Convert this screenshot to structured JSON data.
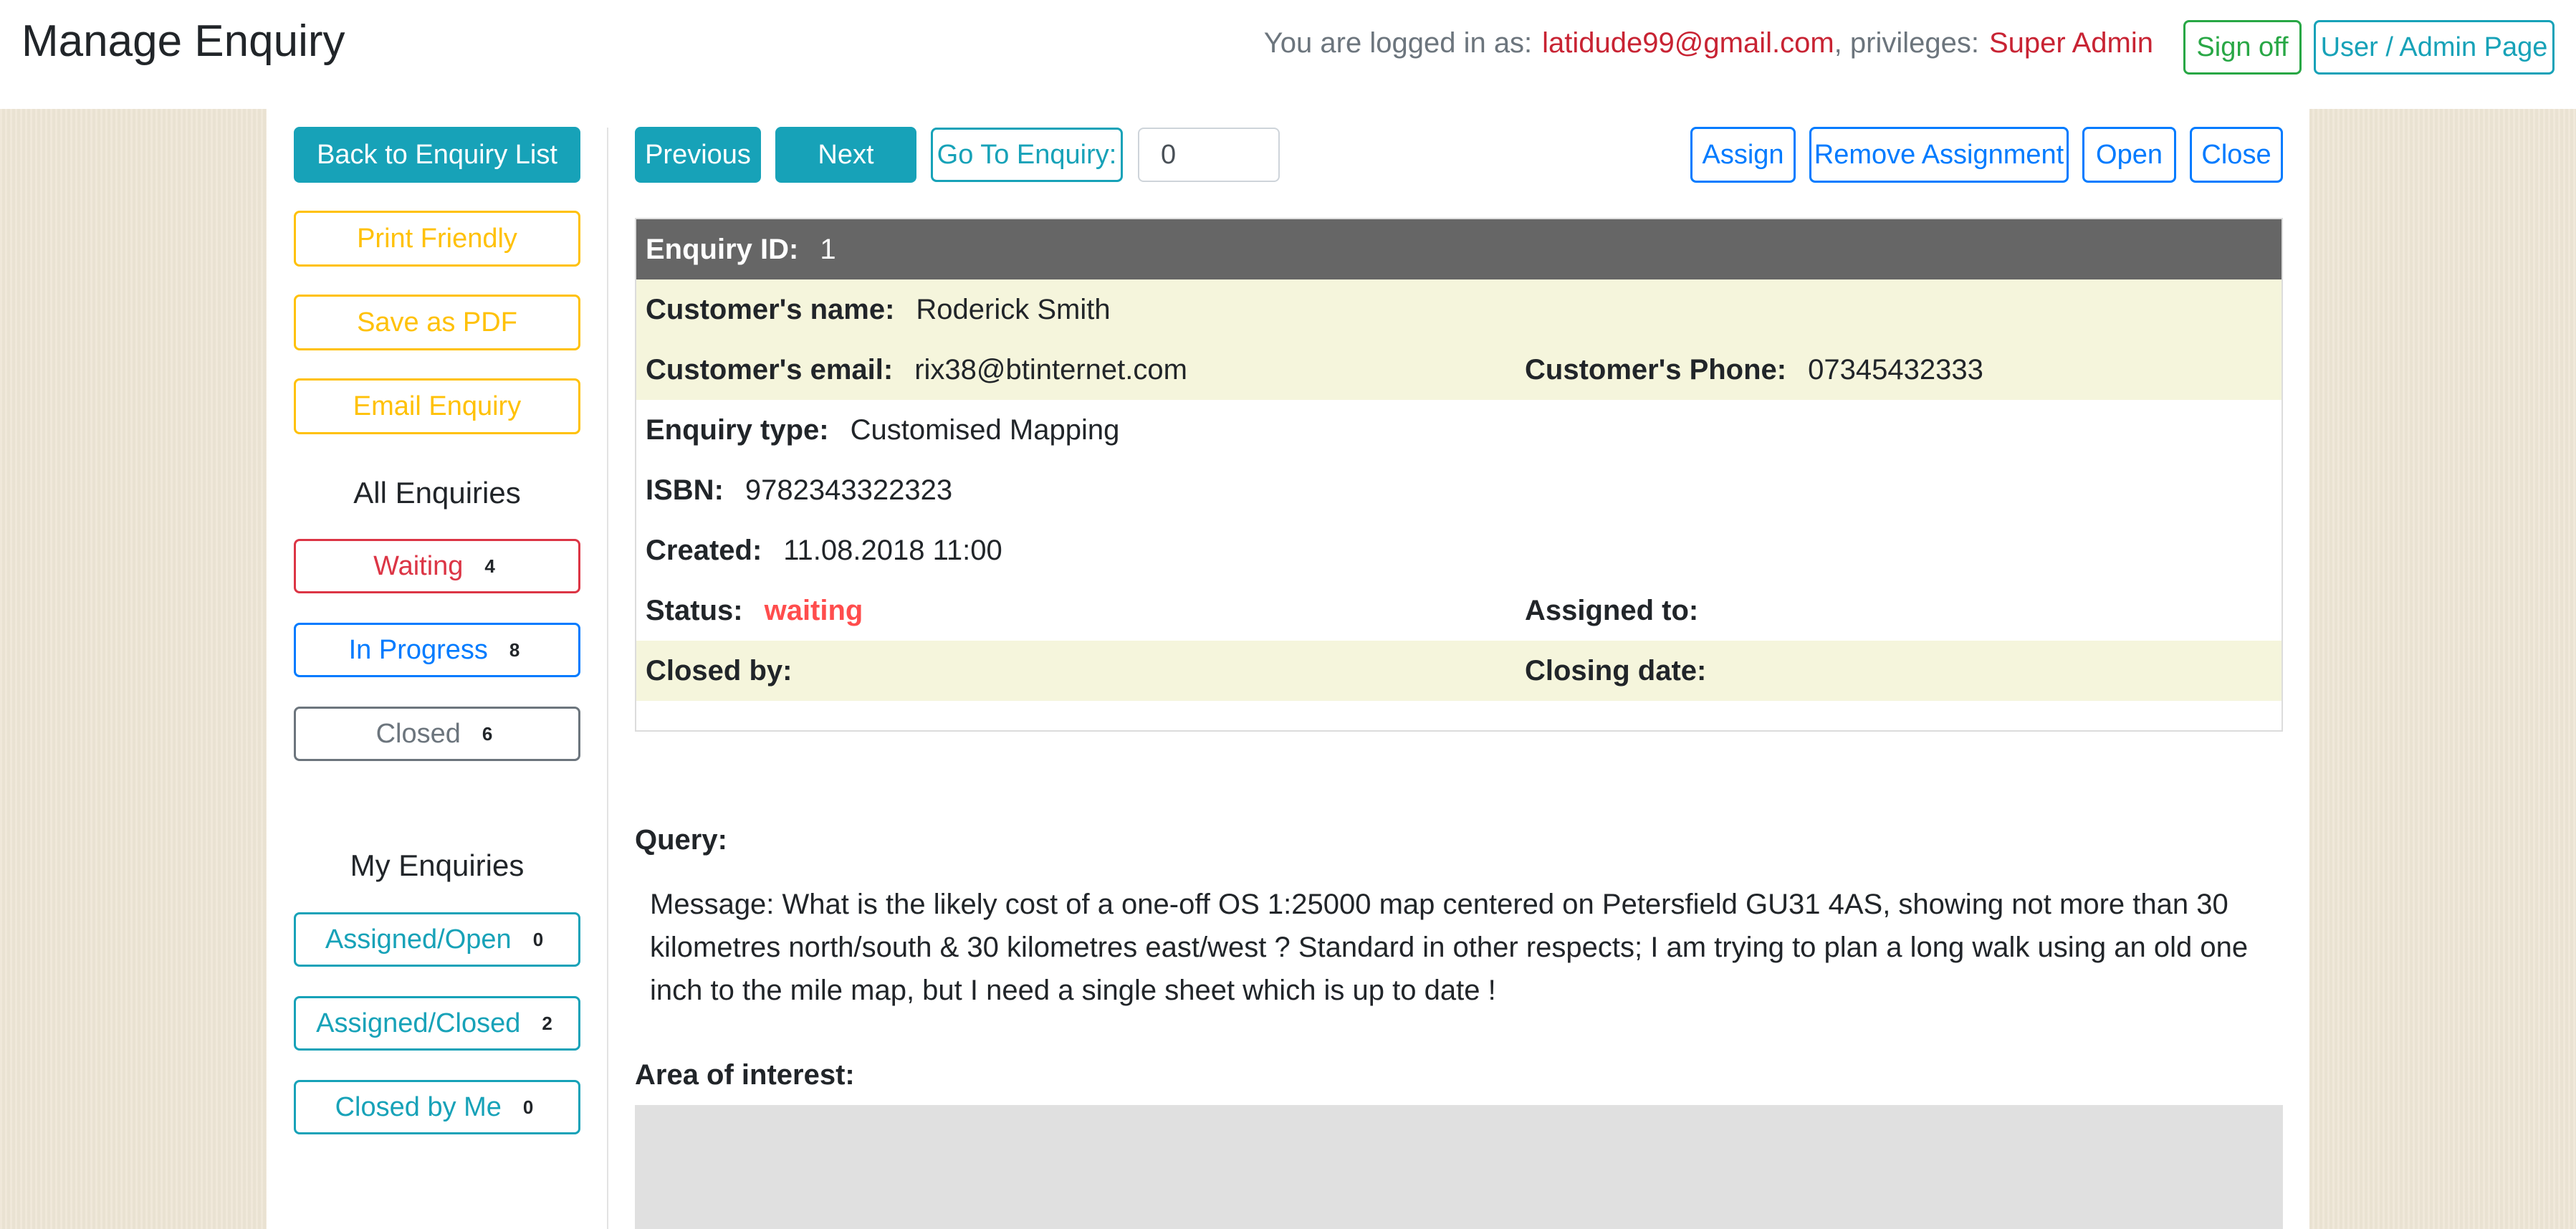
{
  "header": {
    "title": "Manage Enquiry",
    "logged_in_prefix": "You are logged in as:",
    "email": "latidude99@gmail.com",
    "privileges_prefix": ", privileges:",
    "role": "Super Admin",
    "sign_off": "Sign off",
    "user_admin": "User / Admin Page"
  },
  "sidebar": {
    "back": "Back to Enquiry List",
    "print": "Print Friendly",
    "pdf": "Save as PDF",
    "email": "Email Enquiry",
    "all_heading": "All Enquiries",
    "all_items": [
      {
        "label": "Waiting",
        "count": "4"
      },
      {
        "label": "In Progress",
        "count": "8"
      },
      {
        "label": "Closed",
        "count": "6"
      }
    ],
    "my_heading": "My Enquiries",
    "my_items": [
      {
        "label": "Assigned/Open",
        "count": "0"
      },
      {
        "label": "Assigned/Closed",
        "count": "2"
      },
      {
        "label": "Closed by Me",
        "count": "0"
      }
    ]
  },
  "toolbar": {
    "previous": "Previous",
    "next": "Next",
    "goto": "Go To Enquiry:",
    "goto_value": "0",
    "assign": "Assign",
    "remove_assignment": "Remove Assignment",
    "open": "Open",
    "close": "Close"
  },
  "enquiry": {
    "id_label": "Enquiry ID:",
    "id": "1",
    "name_label": "Customer's name:",
    "name": "Roderick Smith",
    "email_label": "Customer's email:",
    "email": "rix38@btinternet.com",
    "phone_label": "Customer's Phone:",
    "phone": "07345432333",
    "type_label": "Enquiry type:",
    "type": "Customised Mapping",
    "isbn_label": "ISBN:",
    "isbn": "9782343322323",
    "created_label": "Created:",
    "created": "11.08.2018 11:00",
    "status_label": "Status:",
    "status": "waiting",
    "assigned_label": "Assigned to:",
    "assigned": "",
    "closed_by_label": "Closed by:",
    "closed_by": "",
    "closing_date_label": "Closing date:",
    "closing_date": ""
  },
  "query": {
    "label": "Query:",
    "message": "Message: What is the likely cost of a one-off OS 1:25000 map centered on Petersfield GU31 4AS, showing not more than 30 kilometres north/south & 30 kilometres east/west ? Standard in other respects; I am trying to plan a long walk using an old one inch to the mile map, but I need a single sheet which is up to date !",
    "area_label": "Area of interest:"
  },
  "colors": {
    "info": "#17a2b8",
    "warning": "#ffc107",
    "danger": "#dc3545",
    "primary": "#007bff",
    "secondary": "#6c757d",
    "success": "#28a745",
    "status_waiting": "#ff4d4d",
    "id_row": "#666666",
    "beige_row": "#f5f5dc"
  }
}
